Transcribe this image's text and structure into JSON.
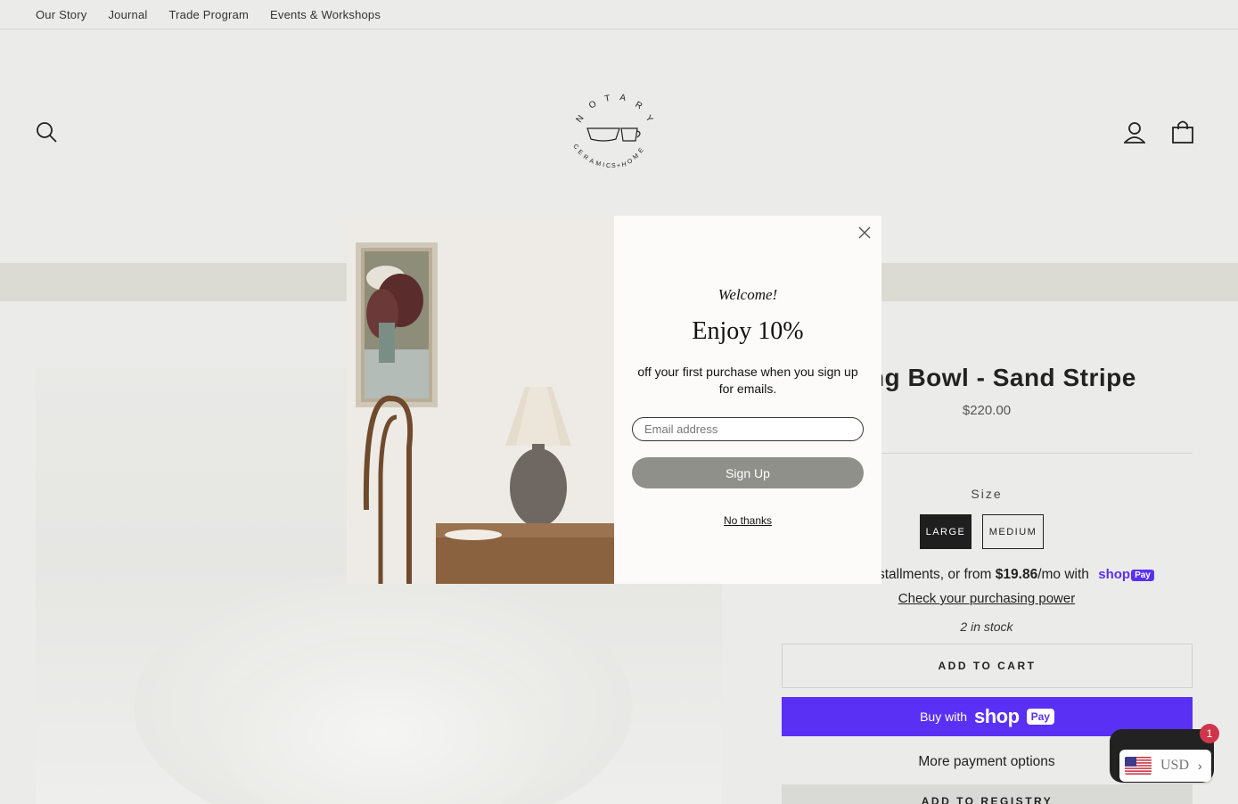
{
  "topnav": {
    "items": [
      "Our Story",
      "Journal",
      "Trade Program",
      "Events & Workshops"
    ]
  },
  "header": {
    "logo_letters": "NOTARY",
    "logo_subtitle": "CERAMICS + HOME",
    "icons": [
      "search-icon",
      "account-icon",
      "cart-icon"
    ]
  },
  "product": {
    "title": "rving Bowl - Sand Stripe",
    "price": "$220.00",
    "size_label": "Size",
    "sizes": [
      "LARGE",
      "MEDIUM"
    ],
    "selected_size": "LARGE",
    "installments_prefix": "e installments, or from ",
    "installments_amount": "$19.86",
    "installments_suffix": "/mo with",
    "shoppay_word": "shop",
    "shoppay_badge": "Pay",
    "check_power": "Check your purchasing power",
    "stock": "2 in stock",
    "add_to_cart": "ADD TO CART",
    "buy_with": "Buy with",
    "buy_logo_shop": "shop",
    "buy_logo_pay": "Pay",
    "more_payment": "More payment options",
    "add_registry": "ADD TO REGISTRY"
  },
  "chat": {
    "badge_count": "1"
  },
  "currency": {
    "code": "USD"
  },
  "modal": {
    "welcome": "Welcome!",
    "headline": "Enjoy 10%",
    "body": "off your first purchase when you sign up for emails.",
    "email_placeholder": "Email address",
    "signup_label": "Sign Up",
    "decline_label": "No thanks"
  },
  "colors": {
    "page_bg": "#ebebe9",
    "banner": "#dbdad3",
    "shop_pay": "#5a31f4",
    "signup_button": "#90908a",
    "chat_badge": "#d0364a"
  }
}
